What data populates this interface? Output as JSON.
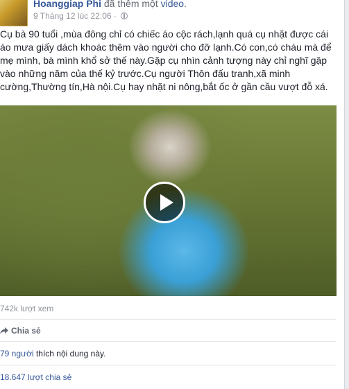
{
  "post": {
    "author": "Hoanggiap Phi",
    "action_prefix": " đã thêm một ",
    "action_link": "video",
    "action_suffix": ".",
    "timestamp": "9 Tháng 12 lúc 22:06",
    "separator": " · ",
    "privacy_icon": "globe-icon",
    "text": "Cụ bà 90 tuổi ,mùa đông chỉ có chiếc áo cộc rách,lạnh quá cụ nhặt được cái áo mưa giấy dách khoác thêm vào người cho đỡ lạnh.Có con,có cháu mà để mẹ mình, bà mình khổ sở thế này.Gặp cụ nhìn cảnh tượng này chỉ nghĩ gặp vào những năm của thế kỷ trước.Cụ người Thôn đấu tranh,xã minh cường,Thường tín,Hà nội.Cụ hay nhặt ni nông,bắt ốc ở gần cầu vượt đỗ xá."
  },
  "video": {
    "play_icon": "play-icon"
  },
  "stats": {
    "views": "742k lượt xem",
    "share_label": "Chia sẻ",
    "likes_link": "79 người",
    "likes_suffix": " thích nội dung này.",
    "shares": "18.647 lượt chia sẻ"
  },
  "colors": {
    "link": "#365899",
    "muted": "#90949c",
    "text": "#1d2129",
    "background": "#e9ebee"
  }
}
